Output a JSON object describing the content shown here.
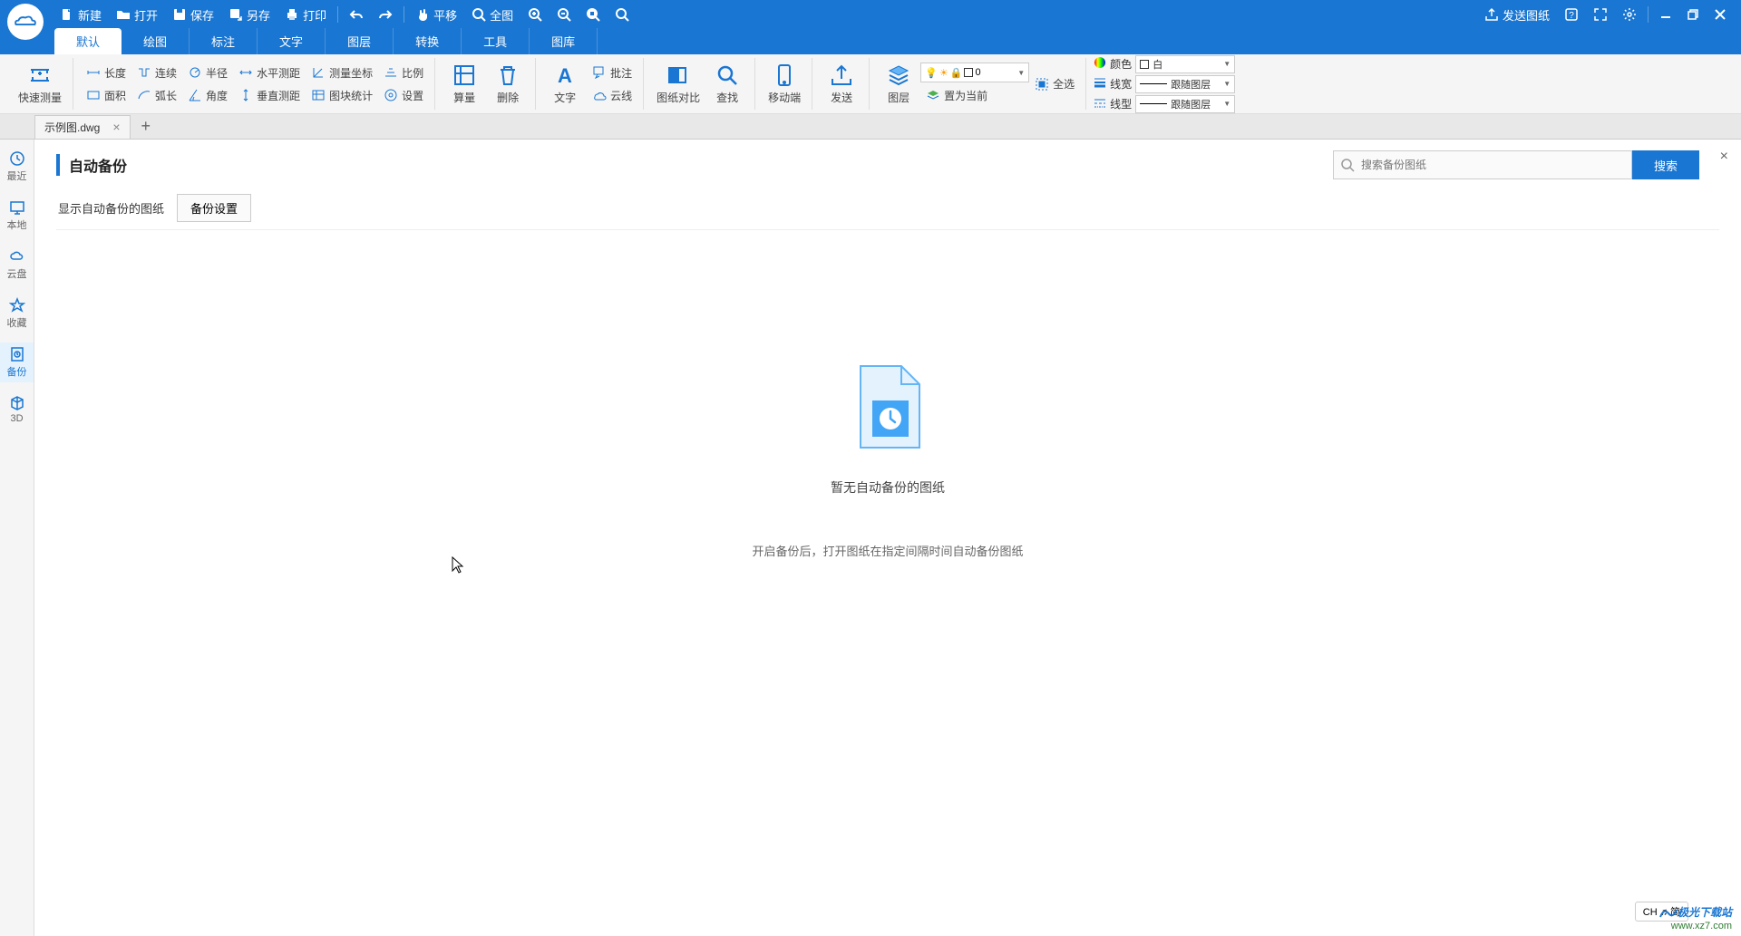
{
  "titlebar": {
    "new": "新建",
    "open": "打开",
    "save": "保存",
    "saveas": "另存",
    "print": "打印",
    "pan": "平移",
    "full": "全图",
    "send": "发送图纸"
  },
  "menu": {
    "t0": "默认",
    "t1": "绘图",
    "t2": "标注",
    "t3": "文字",
    "t4": "图层",
    "t5": "转换",
    "t6": "工具",
    "t7": "图库"
  },
  "ribbon": {
    "quickmeasure": "快速测量",
    "length": "长度",
    "area": "面积",
    "continuous": "连续",
    "arc": "弧长",
    "radius": "半径",
    "angle": "角度",
    "hdist": "水平测距",
    "vdist": "垂直测距",
    "coord": "测量坐标",
    "blockstat": "图块统计",
    "ratio": "比例",
    "settings": "设置",
    "calc": "算量",
    "delete": "删除",
    "text": "文字",
    "anno": "批注",
    "cloud": "云线",
    "compare": "图纸对比",
    "find": "查找",
    "mobile": "移动端",
    "sendbtn": "发送",
    "layer": "图层",
    "setcurrent": "置为当前",
    "selectall": "全选",
    "colorlbl": "颜色",
    "lwlbl": "线宽",
    "ltlbl": "线型",
    "colorval": "白",
    "lwval": "跟随图层",
    "ltval": "跟随图层",
    "layerval": "0"
  },
  "doctab": {
    "name": "示例图.dwg"
  },
  "sidebar": {
    "recent": "最近",
    "local": "本地",
    "cloud": "云盘",
    "fav": "收藏",
    "backup": "备份",
    "threed": "3D"
  },
  "content": {
    "title": "自动备份",
    "tab1": "显示自动备份的图纸",
    "tab2": "备份设置",
    "search_ph": "搜索备份图纸",
    "search_btn": "搜索",
    "empty_title": "暂无自动备份的图纸",
    "empty_sub": "开启备份后，打开图纸在指定间隔时间自动备份图纸"
  },
  "ime": "CH ♫ 简",
  "watermark": {
    "line1": "极光下载站",
    "line2": "www.xz7.com"
  }
}
